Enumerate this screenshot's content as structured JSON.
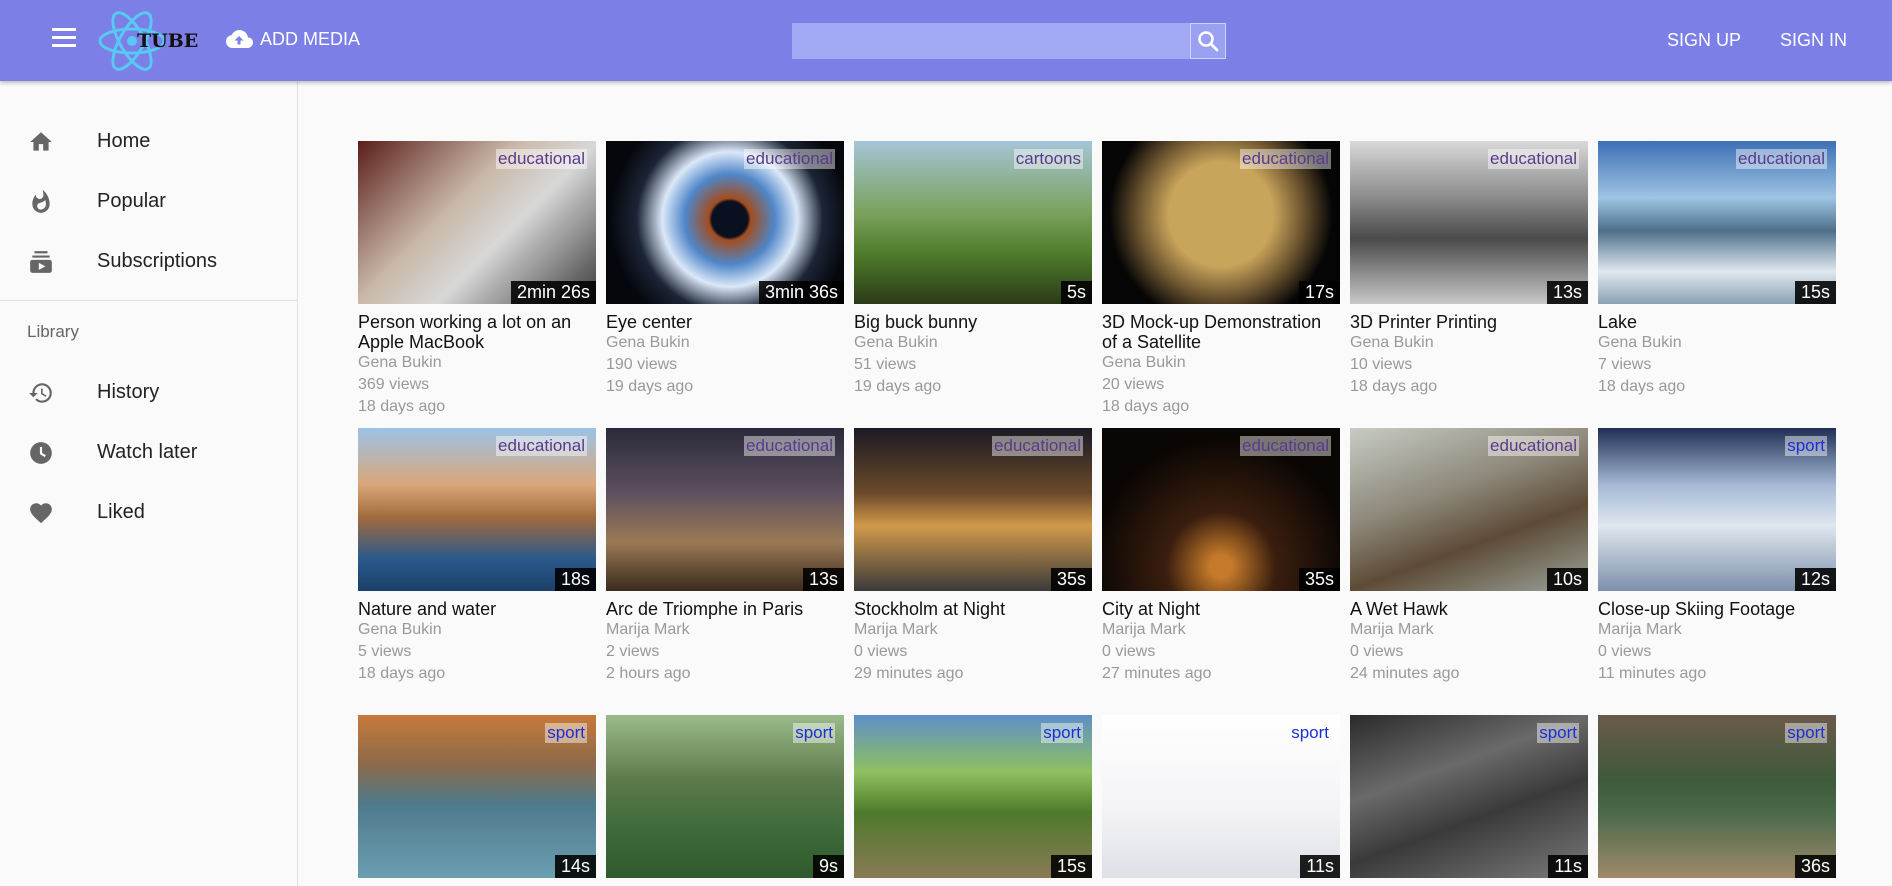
{
  "header": {
    "logo_text": "TUBE",
    "add_media_label": "ADD MEDIA",
    "search_placeholder": "",
    "sign_up_label": "SIGN UP",
    "sign_in_label": "SIGN IN",
    "accent_color": "#7b7fe6"
  },
  "sidebar": {
    "items": [
      {
        "label": "Home",
        "icon": "home-icon"
      },
      {
        "label": "Popular",
        "icon": "flame-icon"
      },
      {
        "label": "Subscriptions",
        "icon": "subscriptions-icon"
      }
    ],
    "library_title": "Library",
    "library_items": [
      {
        "label": "History",
        "icon": "history-icon"
      },
      {
        "label": "Watch later",
        "icon": "clock-icon"
      },
      {
        "label": "Liked",
        "icon": "heart-icon"
      }
    ]
  },
  "videos": [
    {
      "title": "Person working a lot on an Apple MacBook",
      "author": "Gena Bukin",
      "views": "369 views",
      "age": "18 days ago",
      "category": "educational",
      "duration": "2min 26s"
    },
    {
      "title": "Eye center",
      "author": "Gena Bukin",
      "views": "190 views",
      "age": "19 days ago",
      "category": "educational",
      "duration": "3min 36s"
    },
    {
      "title": "Big buck bunny",
      "author": "Gena Bukin",
      "views": "51 views",
      "age": "19 days ago",
      "category": "cartoons",
      "duration": "5s"
    },
    {
      "title": "3D Mock-up Demonstration of a Satellite",
      "author": "Gena Bukin",
      "views": "20 views",
      "age": "18 days ago",
      "category": "educational",
      "duration": "17s"
    },
    {
      "title": "3D Printer Printing",
      "author": "Gena Bukin",
      "views": "10 views",
      "age": "18 days ago",
      "category": "educational",
      "duration": "13s"
    },
    {
      "title": "Lake",
      "author": "Gena Bukin",
      "views": "7 views",
      "age": "18 days ago",
      "category": "educational",
      "duration": "15s"
    },
    {
      "title": "Nature and water",
      "author": "Gena Bukin",
      "views": "5 views",
      "age": "18 days ago",
      "category": "educational",
      "duration": "18s"
    },
    {
      "title": "Arc de Triomphe in Paris",
      "author": "Marija Mark",
      "views": "2 views",
      "age": "2 hours ago",
      "category": "educational",
      "duration": "13s"
    },
    {
      "title": "Stockholm at Night",
      "author": "Marija Mark",
      "views": "0 views",
      "age": "29 minutes ago",
      "category": "educational",
      "duration": "35s"
    },
    {
      "title": "City at Night",
      "author": "Marija Mark",
      "views": "0 views",
      "age": "27 minutes ago",
      "category": "educational",
      "duration": "35s"
    },
    {
      "title": "A Wet Hawk",
      "author": "Marija Mark",
      "views": "0 views",
      "age": "24 minutes ago",
      "category": "educational",
      "duration": "10s"
    },
    {
      "title": "Close-up Skiing Footage",
      "author": "Marija Mark",
      "views": "0 views",
      "age": "11 minutes ago",
      "category": "sport",
      "duration": "12s"
    },
    {
      "title": "",
      "author": "",
      "views": "",
      "age": "",
      "category": "sport",
      "duration": "14s"
    },
    {
      "title": "",
      "author": "",
      "views": "",
      "age": "",
      "category": "sport",
      "duration": "9s"
    },
    {
      "title": "",
      "author": "",
      "views": "",
      "age": "",
      "category": "sport",
      "duration": "15s"
    },
    {
      "title": "",
      "author": "",
      "views": "",
      "age": "",
      "category": "sport",
      "duration": "11s"
    },
    {
      "title": "",
      "author": "",
      "views": "",
      "age": "",
      "category": "sport",
      "duration": "11s"
    },
    {
      "title": "",
      "author": "",
      "views": "",
      "age": "",
      "category": "sport",
      "duration": "36s"
    }
  ]
}
